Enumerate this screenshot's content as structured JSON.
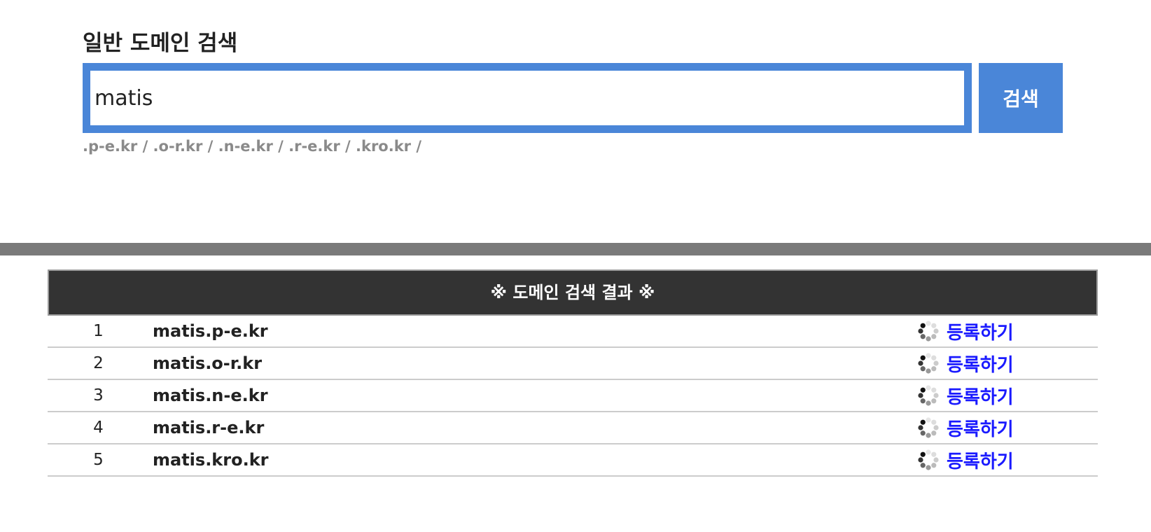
{
  "search": {
    "title": "일반 도메인 검색",
    "input_value": "matis",
    "button_label": "검색",
    "suffix_list": ".p-e.kr / .o-r.kr / .n-e.kr / .r-e.kr / .kro.kr /"
  },
  "results": {
    "header": "※ 도메인 검색 결과 ※",
    "rows": [
      {
        "num": "1",
        "domain": "matis.p-e.kr",
        "action": "등록하기"
      },
      {
        "num": "2",
        "domain": "matis.o-r.kr",
        "action": "등록하기"
      },
      {
        "num": "3",
        "domain": "matis.n-e.kr",
        "action": "등록하기"
      },
      {
        "num": "4",
        "domain": "matis.r-e.kr",
        "action": "등록하기"
      },
      {
        "num": "5",
        "domain": "matis.kro.kr",
        "action": "등록하기"
      }
    ]
  },
  "colors": {
    "accent": "#4a86d8",
    "header_bg": "#333333",
    "link": "#1a1aff",
    "divider": "#7a7a7a"
  },
  "icons": {
    "loading": "loading-spinner-icon"
  }
}
